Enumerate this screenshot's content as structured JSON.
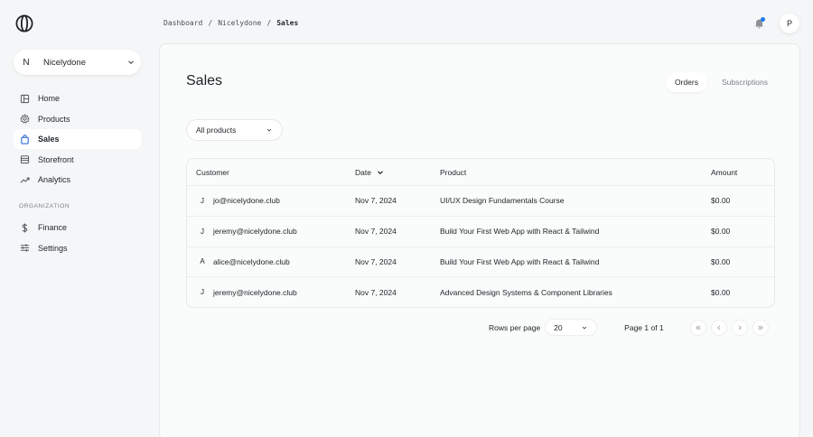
{
  "app": {
    "store_initial": "N",
    "store_name": "Nicelydone",
    "user_initial": "P",
    "notification_dot_color": "#1a7cf0"
  },
  "breadcrumb": [
    "Dashboard",
    "Nicelydone",
    "Sales"
  ],
  "sidebar": {
    "items": [
      {
        "label": "Home",
        "icon": "layout-icon"
      },
      {
        "label": "Products",
        "icon": "cog-icon"
      },
      {
        "label": "Sales",
        "icon": "bag-icon",
        "active": true
      },
      {
        "label": "Storefront",
        "icon": "storefront-icon"
      },
      {
        "label": "Analytics",
        "icon": "trend-icon"
      }
    ],
    "section_label": "ORGANIZATION",
    "org_items": [
      {
        "label": "Finance",
        "icon": "dollar-icon"
      },
      {
        "label": "Settings",
        "icon": "sliders-icon"
      }
    ]
  },
  "page": {
    "title": "Sales",
    "tabs": [
      "Orders",
      "Subscriptions"
    ],
    "filter_value": "All products"
  },
  "table": {
    "headers": {
      "customer": "Customer",
      "date": "Date",
      "product": "Product",
      "amount": "Amount"
    },
    "rows": [
      {
        "initial": "J",
        "customer": "jo@nicelydone.club",
        "date": "Nov 7, 2024",
        "product": "UI/UX Design Fundamentals Course",
        "amount": "$0.00"
      },
      {
        "initial": "J",
        "customer": "jeremy@nicelydone.club",
        "date": "Nov 7, 2024",
        "product": "Build Your First Web App with React & Tailwind",
        "amount": "$0.00"
      },
      {
        "initial": "A",
        "customer": "alice@nicelydone.club",
        "date": "Nov 7, 2024",
        "product": "Build Your First Web App with React & Tailwind",
        "amount": "$0.00"
      },
      {
        "initial": "J",
        "customer": "jeremy@nicelydone.club",
        "date": "Nov 7, 2024",
        "product": "Advanced Design Systems & Component Libraries",
        "amount": "$0.00"
      }
    ]
  },
  "pagination": {
    "rows_label": "Rows per page",
    "rows_value": "20",
    "page_label": "Page 1 of 1"
  }
}
